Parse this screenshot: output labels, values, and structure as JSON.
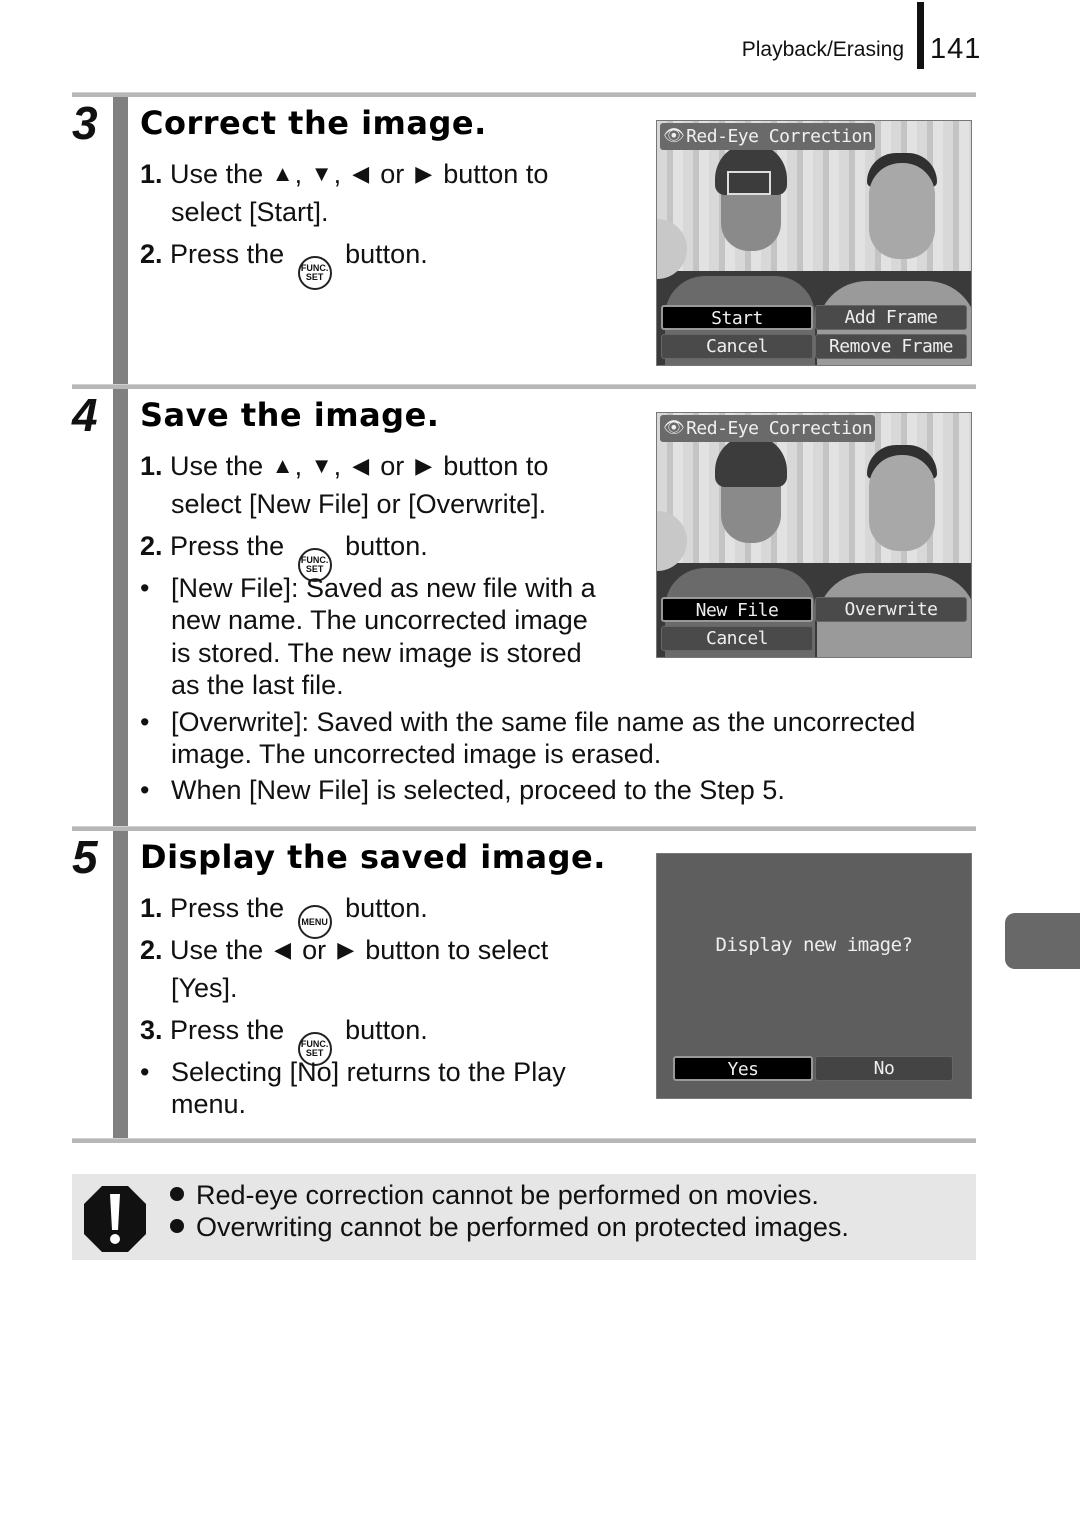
{
  "header": {
    "section": "Playback/Erasing",
    "page_number": "141"
  },
  "steps": [
    {
      "number": "3",
      "title": "Correct the image.",
      "instructions": [
        {
          "num": "1.",
          "text_before": "Use the",
          "arrows": [
            "up-arrow",
            "down-arrow",
            "left-arrow",
            "right-arrow"
          ],
          "text_after": "button to",
          "continuation": "select [Start]."
        },
        {
          "num": "2.",
          "text_before": "Press the",
          "button_icon": "FUNC. SET",
          "text_after": "button."
        }
      ],
      "screen": {
        "title": "Red-Eye Correction",
        "buttons": [
          {
            "label": "Start",
            "selected": true
          },
          {
            "label": "Add Frame",
            "selected": false
          },
          {
            "label": "Cancel",
            "selected": false
          },
          {
            "label": "Remove Frame",
            "selected": false
          }
        ]
      }
    },
    {
      "number": "4",
      "title": "Save the image.",
      "instructions": [
        {
          "num": "1.",
          "text_before": "Use the",
          "arrows": [
            "up-arrow",
            "down-arrow",
            "left-arrow",
            "right-arrow"
          ],
          "text_after": "button to",
          "continuation": "select [New File] or [Overwrite]."
        },
        {
          "num": "2.",
          "text_before": "Press the",
          "button_icon": "FUNC. SET",
          "text_after": "button."
        }
      ],
      "bullets": [
        {
          "lines": [
            "[New File]: Saved as new file with a",
            "new name. The uncorrected image",
            "is stored. The new image is stored",
            "as the last file."
          ]
        },
        {
          "lines": [
            "[Overwrite]: Saved with the same file name as the uncorrected",
            "image. The uncorrected image is erased."
          ]
        },
        {
          "lines": [
            "When [New File] is selected, proceed to the Step 5."
          ]
        }
      ],
      "screen": {
        "title": "Red-Eye Correction",
        "buttons": [
          {
            "label": "New File",
            "selected": true
          },
          {
            "label": "Overwrite",
            "selected": false
          },
          {
            "label": "Cancel",
            "selected": false
          }
        ]
      }
    },
    {
      "number": "5",
      "title": "Display the saved image.",
      "instructions": [
        {
          "num": "1.",
          "text_before": "Press the",
          "button_icon": "MENU",
          "text_after": "button."
        },
        {
          "num": "2.",
          "text_before": "Use the",
          "arrows": [
            "left-arrow",
            "right-arrow"
          ],
          "text_after": "button to select",
          "continuation": "[Yes]."
        },
        {
          "num": "3.",
          "text_before": "Press the",
          "button_icon": "FUNC. SET",
          "text_after": "button."
        }
      ],
      "bullets": [
        {
          "lines": [
            "Selecting [No] returns to the Play",
            "menu."
          ]
        }
      ],
      "screen": {
        "message": "Display new image?",
        "buttons": [
          {
            "label": "Yes",
            "selected": true
          },
          {
            "label": "No",
            "selected": false
          }
        ]
      }
    }
  ],
  "text": {
    "comma": ",",
    "or": "or",
    "bullet": "•",
    "func_top": "FUNC.",
    "func_bottom": "SET",
    "menu": "MENU"
  },
  "caution": {
    "icon": "caution-icon",
    "items": [
      "Red-eye correction cannot be performed on movies.",
      "Overwriting cannot be performed on protected images."
    ]
  }
}
